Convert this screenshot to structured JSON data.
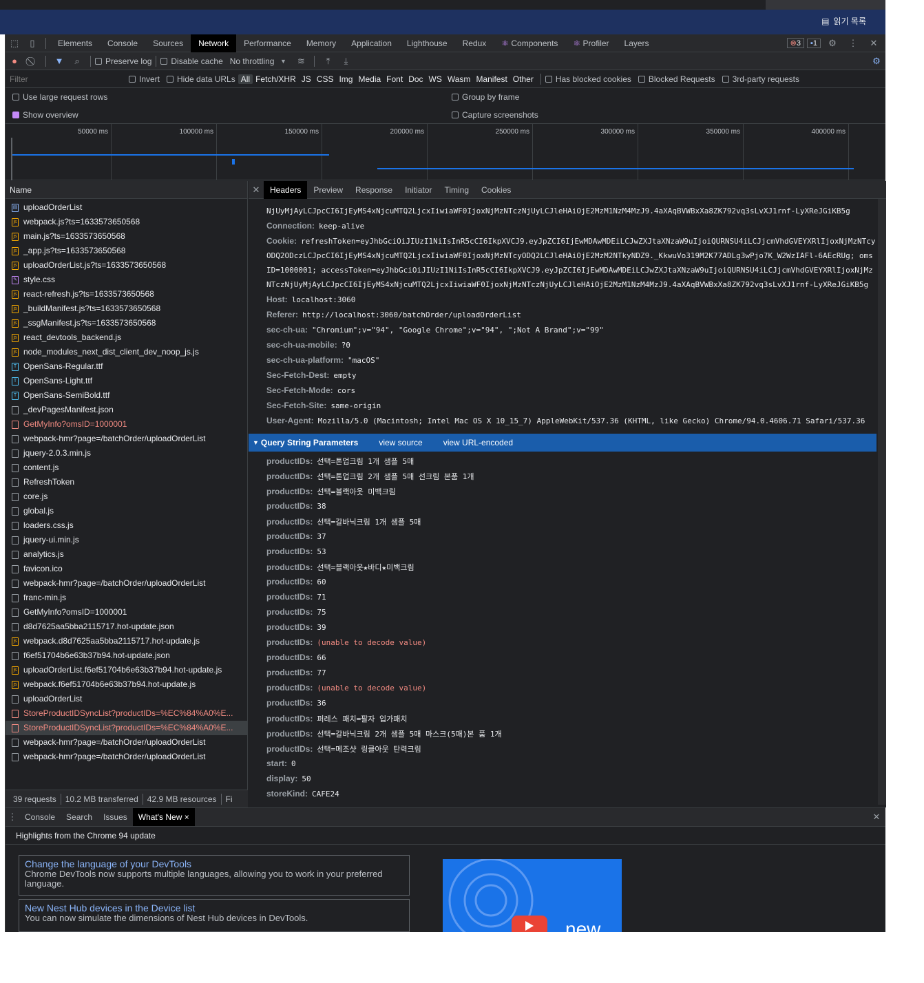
{
  "browser": {
    "reading_list_label": "읽기 목록"
  },
  "main_tabs": [
    "Elements",
    "Console",
    "Sources",
    "Network",
    "Performance",
    "Memory",
    "Application",
    "Lighthouse",
    "Redux",
    "Components",
    "Profiler",
    "Layers"
  ],
  "badges": {
    "errors": "3",
    "messages": "1"
  },
  "net_toolbar": {
    "preserve_log": "Preserve log",
    "disable_cache": "Disable cache",
    "throttling": "No throttling"
  },
  "filter": {
    "placeholder": "Filter",
    "invert": "Invert",
    "hide_data_urls": "Hide data URLs",
    "types": [
      "All",
      "Fetch/XHR",
      "JS",
      "CSS",
      "Img",
      "Media",
      "Font",
      "Doc",
      "WS",
      "Wasm",
      "Manifest",
      "Other"
    ],
    "has_blocked_cookies": "Has blocked cookies",
    "blocked_requests": "Blocked Requests",
    "third_party": "3rd-party requests"
  },
  "options": {
    "large_rows": "Use large request rows",
    "group_by_frame": "Group by frame",
    "show_overview": "Show overview",
    "capture_screenshots": "Capture screenshots"
  },
  "overview_ticks": [
    "50000 ms",
    "100000 ms",
    "150000 ms",
    "200000 ms",
    "250000 ms",
    "300000 ms",
    "350000 ms",
    "400000 ms"
  ],
  "name_header": "Name",
  "requests": [
    {
      "name": "uploadOrderList",
      "type": "doc",
      "error": false
    },
    {
      "name": "webpack.js?ts=1633573650568",
      "type": "js",
      "error": false
    },
    {
      "name": "main.js?ts=1633573650568",
      "type": "js",
      "error": false
    },
    {
      "name": "_app.js?ts=1633573650568",
      "type": "js",
      "error": false
    },
    {
      "name": "uploadOrderList.js?ts=1633573650568",
      "type": "js",
      "error": false
    },
    {
      "name": "style.css",
      "type": "css",
      "error": false
    },
    {
      "name": "react-refresh.js?ts=1633573650568",
      "type": "js",
      "error": false
    },
    {
      "name": "_buildManifest.js?ts=1633573650568",
      "type": "js",
      "error": false
    },
    {
      "name": "_ssgManifest.js?ts=1633573650568",
      "type": "js",
      "error": false
    },
    {
      "name": "react_devtools_backend.js",
      "type": "js",
      "error": false
    },
    {
      "name": "node_modules_next_dist_client_dev_noop_js.js",
      "type": "js",
      "error": false
    },
    {
      "name": "OpenSans-Regular.ttf",
      "type": "font",
      "error": false
    },
    {
      "name": "OpenSans-Light.ttf",
      "type": "font",
      "error": false
    },
    {
      "name": "OpenSans-SemiBold.ttf",
      "type": "font",
      "error": false
    },
    {
      "name": "_devPagesManifest.json",
      "type": "other",
      "error": false
    },
    {
      "name": "GetMyInfo?omsID=1000001",
      "type": "other",
      "error": true
    },
    {
      "name": "webpack-hmr?page=/batchOrder/uploadOrderList",
      "type": "other",
      "error": false
    },
    {
      "name": "jquery-2.0.3.min.js",
      "type": "other",
      "error": false
    },
    {
      "name": "content.js",
      "type": "other",
      "error": false
    },
    {
      "name": "RefreshToken",
      "type": "other",
      "error": false
    },
    {
      "name": "core.js",
      "type": "other",
      "error": false
    },
    {
      "name": "global.js",
      "type": "other",
      "error": false
    },
    {
      "name": "loaders.css.js",
      "type": "other",
      "error": false
    },
    {
      "name": "jquery-ui.min.js",
      "type": "other",
      "error": false
    },
    {
      "name": "analytics.js",
      "type": "other",
      "error": false
    },
    {
      "name": "favicon.ico",
      "type": "other",
      "error": false
    },
    {
      "name": "webpack-hmr?page=/batchOrder/uploadOrderList",
      "type": "other",
      "error": false
    },
    {
      "name": "franc-min.js",
      "type": "other",
      "error": false
    },
    {
      "name": "GetMyInfo?omsID=1000001",
      "type": "other",
      "error": false
    },
    {
      "name": "d8d7625aa5bba2115717.hot-update.json",
      "type": "other",
      "error": false
    },
    {
      "name": "webpack.d8d7625aa5bba2115717.hot-update.js",
      "type": "js",
      "error": false
    },
    {
      "name": "f6ef51704b6e63b37b94.hot-update.json",
      "type": "other",
      "error": false
    },
    {
      "name": "uploadOrderList.f6ef51704b6e63b37b94.hot-update.js",
      "type": "js",
      "error": false
    },
    {
      "name": "webpack.f6ef51704b6e63b37b94.hot-update.js",
      "type": "js",
      "error": false
    },
    {
      "name": "uploadOrderList",
      "type": "other",
      "error": false
    },
    {
      "name": "StoreProductIDSyncList?productIDs=%EC%84%A0%E...",
      "type": "other",
      "error": true
    },
    {
      "name": "StoreProductIDSyncList?productIDs=%EC%84%A0%E...",
      "type": "other",
      "error": true,
      "selected": true
    },
    {
      "name": "webpack-hmr?page=/batchOrder/uploadOrderList",
      "type": "other",
      "error": false
    },
    {
      "name": "webpack-hmr?page=/batchOrder/uploadOrderList",
      "type": "other",
      "error": false
    }
  ],
  "status": {
    "requests": "39 requests",
    "transferred": "10.2 MB transferred",
    "resources": "42.9 MB resources",
    "finish": "Fi"
  },
  "detail_tabs": [
    "Headers",
    "Preview",
    "Response",
    "Initiator",
    "Timing",
    "Cookies"
  ],
  "req_headers": {
    "token_tail": "NjUyMjAyLCJpcCI6IjEyMS4xNjcuMTQ2LjcxIiwiaWF0IjoxNjMzNTczNjUyLCJleHAiOjE2MzM1NzM4MzJ9.4aXAqBVWBxXa8ZK792vq3sLvXJ1rnf-LyXReJGiKB5g",
    "connection_key": "Connection:",
    "connection": "keep-alive",
    "cookie_key": "Cookie:",
    "cookie_lines": [
      "refreshToken=eyJhbGciOiJIUzI1NiIsInR5cCI6IkpXVCJ9.eyJpZCI6IjEwMDAwMDEiLCJwZXJtaXNzaW9uIjoiQURNSU4iLCJjcmVhdGVEYXRlIjoxNjMzNTcy",
      "ODQ2ODczLCJpcCI6IjEyMS4xNjcuMTQ2LjcxIiwiaWF0IjoxNjMzNTcyODQ2LCJleHAiOjE2MzM2NTkyNDZ9._KkwuVo319M2K77ADLg3wPjo7K_W2WzIAFl-6AEcRUg; oms",
      "ID=1000001; accessToken=eyJhbGciOiJIUzI1NiIsInR5cCI6IkpXVCJ9.eyJpZCI6IjEwMDAwMDEiLCJwZXJtaXNzaW9uIjoiQURNSU4iLCJjcmVhdGVEYXRlIjoxNjMz",
      "NTczNjUyMjAyLCJpcCI6IjEyMS4xNjcuMTQ2LjcxIiwiaWF0IjoxNjMzNTczNjUyLCJleHAiOjE2MzM1NzM4MzJ9.4aXAqBVWBxXa8ZK792vq3sLvXJ1rnf-LyXReJGiKB5g"
    ],
    "host_key": "Host:",
    "host": "localhost:3060",
    "referer_key": "Referer:",
    "referer": "http://localhost:3060/batchOrder/uploadOrderList",
    "ua_key": "sec-ch-ua:",
    "ua": "\"Chromium\";v=\"94\", \"Google Chrome\";v=\"94\", \";Not A Brand\";v=\"99\"",
    "mobile_key": "sec-ch-ua-mobile:",
    "mobile": "?0",
    "platform_key": "sec-ch-ua-platform:",
    "platform": "\"macOS\"",
    "dest_key": "Sec-Fetch-Dest:",
    "dest": "empty",
    "mode_key": "Sec-Fetch-Mode:",
    "mode": "cors",
    "site_key": "Sec-Fetch-Site:",
    "site": "same-origin",
    "agent_key": "User-Agent:",
    "agent": "Mozilla/5.0 (Macintosh; Intel Mac OS X 10_15_7) AppleWebKit/537.36 (KHTML, like Gecko) Chrome/94.0.4606.71 Safari/537.36"
  },
  "query_section": {
    "title": "Query String Parameters",
    "view_source": "view source",
    "view_url_encoded": "view URL-encoded"
  },
  "query_params": [
    {
      "k": "productIDs:",
      "v": "선택=톤업크림 1개 샘플 5매",
      "err": false
    },
    {
      "k": "productIDs:",
      "v": "선택=톤업크림 2개 샘플 5매 선크림 본품 1개",
      "err": false
    },
    {
      "k": "productIDs:",
      "v": "선택=블랙아웃 미백크림",
      "err": false
    },
    {
      "k": "productIDs:",
      "v": "38",
      "err": false
    },
    {
      "k": "productIDs:",
      "v": "선택=갈바닉크림 1개 샘플 5매",
      "err": false
    },
    {
      "k": "productIDs:",
      "v": "37",
      "err": false
    },
    {
      "k": "productIDs:",
      "v": "53",
      "err": false
    },
    {
      "k": "productIDs:",
      "v": "선택=블랙아웃★바디★미백크림",
      "err": false
    },
    {
      "k": "productIDs:",
      "v": "60",
      "err": false
    },
    {
      "k": "productIDs:",
      "v": "71",
      "err": false
    },
    {
      "k": "productIDs:",
      "v": "75",
      "err": false
    },
    {
      "k": "productIDs:",
      "v": "39",
      "err": false
    },
    {
      "k": "productIDs:",
      "v": "(unable to decode value)",
      "err": true
    },
    {
      "k": "productIDs:",
      "v": "66",
      "err": false
    },
    {
      "k": "productIDs:",
      "v": "77",
      "err": false
    },
    {
      "k": "productIDs:",
      "v": "(unable to decode value)",
      "err": true
    },
    {
      "k": "productIDs:",
      "v": "36",
      "err": false
    },
    {
      "k": "productIDs:",
      "v": "퍼레스 패치=팔자 입가패치",
      "err": false
    },
    {
      "k": "productIDs:",
      "v": "선택=갈바닉크림 2개 샘플 5매  마스크(5매)본 품 1개",
      "err": false
    },
    {
      "k": "productIDs:",
      "v": "선택=메조샷 링클아웃 탄력크림",
      "err": false
    },
    {
      "k": "start:",
      "v": "0",
      "err": false
    },
    {
      "k": "display:",
      "v": "50",
      "err": false
    },
    {
      "k": "storeKind:",
      "v": "CAFE24",
      "err": false
    }
  ],
  "drawer_tabs": [
    "Console",
    "Search",
    "Issues",
    "What's New"
  ],
  "whats_new": {
    "highlights": "Highlights from the Chrome 94 update",
    "cards": [
      {
        "title": "Change the language of your DevTools",
        "desc": "Chrome DevTools now supports multiple languages, allowing you to work in your preferred language."
      },
      {
        "title": "New Nest Hub devices in the Device list",
        "desc": "You can now simulate the dimensions of Nest Hub devices in DevTools."
      }
    ],
    "promo_text": "new"
  },
  "colors": {
    "accent": "#1a5dab",
    "error": "#f28b82",
    "link": "#8ab4f8",
    "active_tab_bg": "#000000"
  }
}
